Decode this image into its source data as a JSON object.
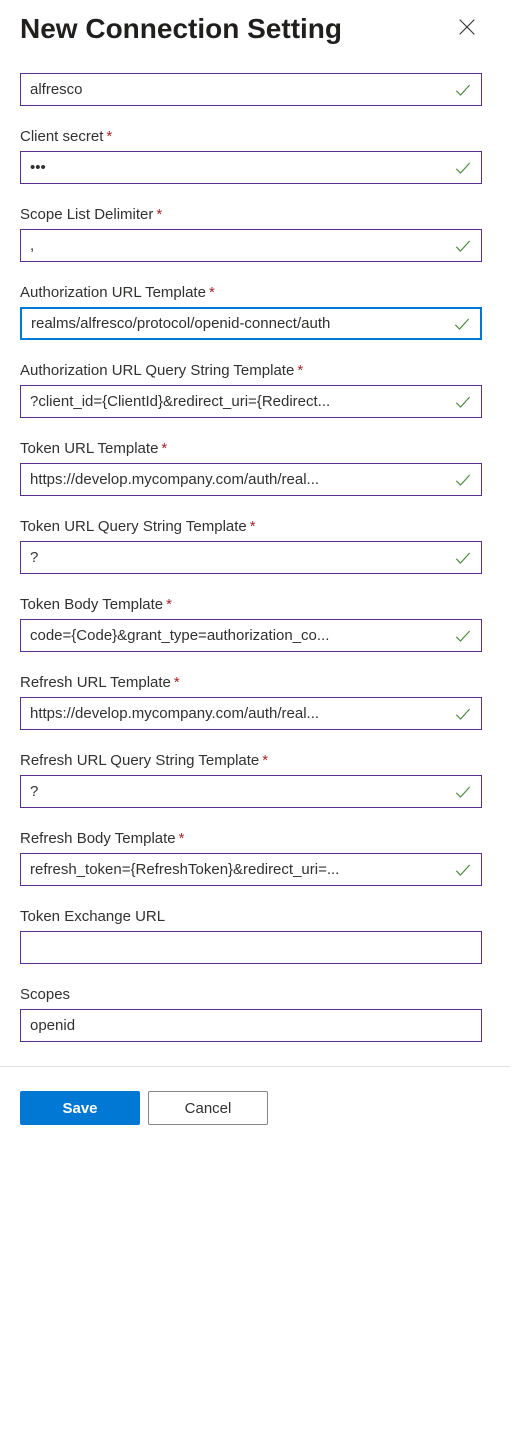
{
  "header": {
    "title": "New Connection Setting"
  },
  "fields": {
    "clientId": {
      "value": "alfresco"
    },
    "clientSecret": {
      "label": "Client secret",
      "value": "•••"
    },
    "scopeListDelimiter": {
      "label": "Scope List Delimiter",
      "value": ","
    },
    "authUrlTemplate": {
      "label": "Authorization URL Template",
      "value": "realms/alfresco/protocol/openid-connect/auth"
    },
    "authUrlQueryTemplate": {
      "label": "Authorization URL Query String Template",
      "value": "?client_id={ClientId}&redirect_uri={Redirect..."
    },
    "tokenUrlTemplate": {
      "label": "Token URL Template",
      "value": "https://develop.mycompany.com/auth/real..."
    },
    "tokenUrlQueryTemplate": {
      "label": "Token URL Query String Template",
      "value": "?"
    },
    "tokenBodyTemplate": {
      "label": "Token Body Template",
      "value": "code={Code}&grant_type=authorization_co..."
    },
    "refreshUrlTemplate": {
      "label": "Refresh URL Template",
      "value": "https://develop.mycompany.com/auth/real..."
    },
    "refreshUrlQueryTemplate": {
      "label": "Refresh URL Query String Template",
      "value": "?"
    },
    "refreshBodyTemplate": {
      "label": "Refresh Body Template",
      "value": "refresh_token={RefreshToken}&redirect_uri=..."
    },
    "tokenExchangeUrl": {
      "label": "Token Exchange URL",
      "value": ""
    },
    "scopes": {
      "label": "Scopes",
      "value": "openid"
    }
  },
  "footer": {
    "save": "Save",
    "cancel": "Cancel"
  }
}
